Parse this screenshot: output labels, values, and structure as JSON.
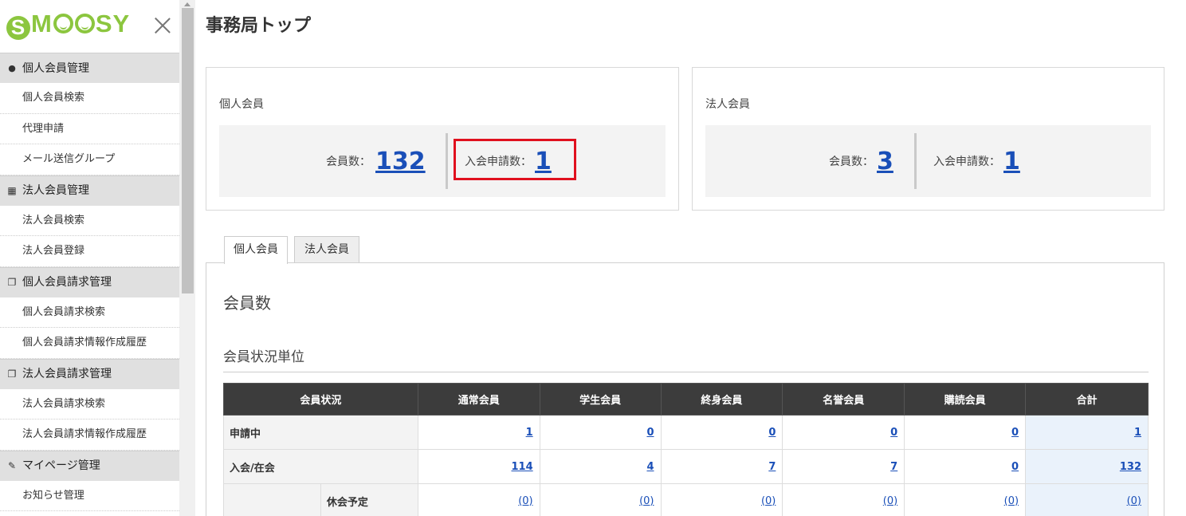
{
  "logo": {
    "s": "S",
    "m": "M",
    "rest": "SY"
  },
  "page": {
    "title": "事務局トップ"
  },
  "sidebar": {
    "sections": [
      {
        "label": "個人会員管理",
        "icon": "person-icon",
        "items": [
          "個人会員検索",
          "代理申請",
          "メール送信グループ"
        ]
      },
      {
        "label": "法人会員管理",
        "icon": "building-icon",
        "items": [
          "法人会員検索",
          "法人会員登録"
        ]
      },
      {
        "label": "個人会員請求管理",
        "icon": "document-icon",
        "items": [
          "個人会員請求検索",
          "個人会員請求情報作成履歴"
        ]
      },
      {
        "label": "法人会員請求管理",
        "icon": "document-icon",
        "items": [
          "法人会員請求検索",
          "法人会員請求情報作成履歴"
        ]
      },
      {
        "label": "マイページ管理",
        "icon": "pencil-icon",
        "items": [
          "お知らせ管理"
        ]
      }
    ]
  },
  "summary": {
    "individual": {
      "title": "個人会員",
      "members_label": "会員数：",
      "members_value": "132",
      "applications_label": "入会申請数：",
      "applications_value": "1"
    },
    "corporate": {
      "title": "法人会員",
      "members_label": "会員数：",
      "members_value": "3",
      "applications_label": "入会申請数：",
      "applications_value": "1"
    }
  },
  "tabs": [
    {
      "label": "個人会員",
      "active": true
    },
    {
      "label": "法人会員",
      "active": false
    }
  ],
  "panel": {
    "title": "会員数",
    "section_title": "会員状況単位",
    "table": {
      "headers": [
        "会員状況",
        "通常会員",
        "学生会員",
        "終身会員",
        "名誉会員",
        "購読会員",
        "合計"
      ],
      "rows": [
        {
          "label": "申請中",
          "values": [
            "1",
            "0",
            "0",
            "0",
            "0",
            "1"
          ]
        },
        {
          "label": "入会/在会",
          "values": [
            "114",
            "4",
            "7",
            "7",
            "0",
            "132"
          ]
        },
        {
          "label": "",
          "sublabel": "休会予定",
          "values": [
            "(0)",
            "(0)",
            "(0)",
            "(0)",
            "(0)",
            "(0)"
          ]
        }
      ]
    }
  },
  "colors": {
    "brand": "#8cc63f",
    "link": "#1a4fb8",
    "highlight": "#e0101e",
    "table_header": "#3c3c3c"
  }
}
